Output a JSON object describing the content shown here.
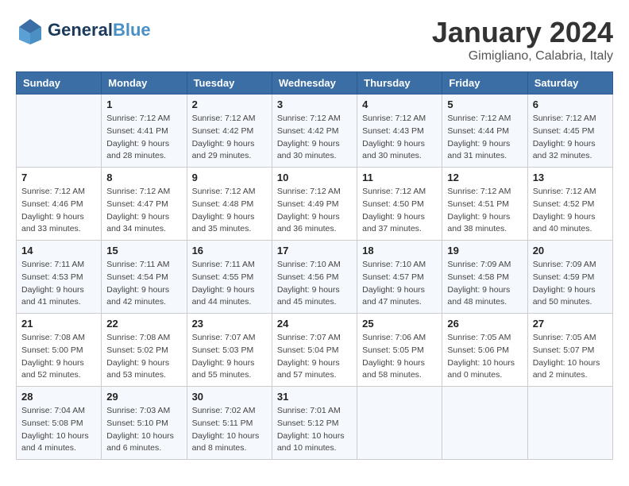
{
  "header": {
    "logo_line1": "General",
    "logo_line2": "Blue",
    "month_title": "January 2024",
    "location": "Gimigliano, Calabria, Italy"
  },
  "days_of_week": [
    "Sunday",
    "Monday",
    "Tuesday",
    "Wednesday",
    "Thursday",
    "Friday",
    "Saturday"
  ],
  "weeks": [
    [
      {
        "day": "",
        "info": ""
      },
      {
        "day": "1",
        "info": "Sunrise: 7:12 AM\nSunset: 4:41 PM\nDaylight: 9 hours\nand 28 minutes."
      },
      {
        "day": "2",
        "info": "Sunrise: 7:12 AM\nSunset: 4:42 PM\nDaylight: 9 hours\nand 29 minutes."
      },
      {
        "day": "3",
        "info": "Sunrise: 7:12 AM\nSunset: 4:42 PM\nDaylight: 9 hours\nand 30 minutes."
      },
      {
        "day": "4",
        "info": "Sunrise: 7:12 AM\nSunset: 4:43 PM\nDaylight: 9 hours\nand 30 minutes."
      },
      {
        "day": "5",
        "info": "Sunrise: 7:12 AM\nSunset: 4:44 PM\nDaylight: 9 hours\nand 31 minutes."
      },
      {
        "day": "6",
        "info": "Sunrise: 7:12 AM\nSunset: 4:45 PM\nDaylight: 9 hours\nand 32 minutes."
      }
    ],
    [
      {
        "day": "7",
        "info": "Sunrise: 7:12 AM\nSunset: 4:46 PM\nDaylight: 9 hours\nand 33 minutes."
      },
      {
        "day": "8",
        "info": "Sunrise: 7:12 AM\nSunset: 4:47 PM\nDaylight: 9 hours\nand 34 minutes."
      },
      {
        "day": "9",
        "info": "Sunrise: 7:12 AM\nSunset: 4:48 PM\nDaylight: 9 hours\nand 35 minutes."
      },
      {
        "day": "10",
        "info": "Sunrise: 7:12 AM\nSunset: 4:49 PM\nDaylight: 9 hours\nand 36 minutes."
      },
      {
        "day": "11",
        "info": "Sunrise: 7:12 AM\nSunset: 4:50 PM\nDaylight: 9 hours\nand 37 minutes."
      },
      {
        "day": "12",
        "info": "Sunrise: 7:12 AM\nSunset: 4:51 PM\nDaylight: 9 hours\nand 38 minutes."
      },
      {
        "day": "13",
        "info": "Sunrise: 7:12 AM\nSunset: 4:52 PM\nDaylight: 9 hours\nand 40 minutes."
      }
    ],
    [
      {
        "day": "14",
        "info": "Sunrise: 7:11 AM\nSunset: 4:53 PM\nDaylight: 9 hours\nand 41 minutes."
      },
      {
        "day": "15",
        "info": "Sunrise: 7:11 AM\nSunset: 4:54 PM\nDaylight: 9 hours\nand 42 minutes."
      },
      {
        "day": "16",
        "info": "Sunrise: 7:11 AM\nSunset: 4:55 PM\nDaylight: 9 hours\nand 44 minutes."
      },
      {
        "day": "17",
        "info": "Sunrise: 7:10 AM\nSunset: 4:56 PM\nDaylight: 9 hours\nand 45 minutes."
      },
      {
        "day": "18",
        "info": "Sunrise: 7:10 AM\nSunset: 4:57 PM\nDaylight: 9 hours\nand 47 minutes."
      },
      {
        "day": "19",
        "info": "Sunrise: 7:09 AM\nSunset: 4:58 PM\nDaylight: 9 hours\nand 48 minutes."
      },
      {
        "day": "20",
        "info": "Sunrise: 7:09 AM\nSunset: 4:59 PM\nDaylight: 9 hours\nand 50 minutes."
      }
    ],
    [
      {
        "day": "21",
        "info": "Sunrise: 7:08 AM\nSunset: 5:00 PM\nDaylight: 9 hours\nand 52 minutes."
      },
      {
        "day": "22",
        "info": "Sunrise: 7:08 AM\nSunset: 5:02 PM\nDaylight: 9 hours\nand 53 minutes."
      },
      {
        "day": "23",
        "info": "Sunrise: 7:07 AM\nSunset: 5:03 PM\nDaylight: 9 hours\nand 55 minutes."
      },
      {
        "day": "24",
        "info": "Sunrise: 7:07 AM\nSunset: 5:04 PM\nDaylight: 9 hours\nand 57 minutes."
      },
      {
        "day": "25",
        "info": "Sunrise: 7:06 AM\nSunset: 5:05 PM\nDaylight: 9 hours\nand 58 minutes."
      },
      {
        "day": "26",
        "info": "Sunrise: 7:05 AM\nSunset: 5:06 PM\nDaylight: 10 hours\nand 0 minutes."
      },
      {
        "day": "27",
        "info": "Sunrise: 7:05 AM\nSunset: 5:07 PM\nDaylight: 10 hours\nand 2 minutes."
      }
    ],
    [
      {
        "day": "28",
        "info": "Sunrise: 7:04 AM\nSunset: 5:08 PM\nDaylight: 10 hours\nand 4 minutes."
      },
      {
        "day": "29",
        "info": "Sunrise: 7:03 AM\nSunset: 5:10 PM\nDaylight: 10 hours\nand 6 minutes."
      },
      {
        "day": "30",
        "info": "Sunrise: 7:02 AM\nSunset: 5:11 PM\nDaylight: 10 hours\nand 8 minutes."
      },
      {
        "day": "31",
        "info": "Sunrise: 7:01 AM\nSunset: 5:12 PM\nDaylight: 10 hours\nand 10 minutes."
      },
      {
        "day": "",
        "info": ""
      },
      {
        "day": "",
        "info": ""
      },
      {
        "day": "",
        "info": ""
      }
    ]
  ]
}
